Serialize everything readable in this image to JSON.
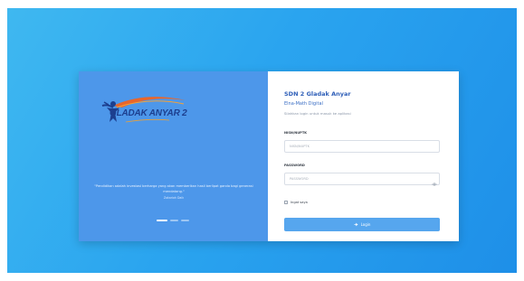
{
  "brand": {
    "logo_text": "GLADAK ANYAR 2"
  },
  "quote": {
    "text": "\"Pendidikan adalah investasi berharga yang akan memberikan hasil berlipat ganda bagi generasi mendatang.\"",
    "author": "Zakariah Daik"
  },
  "carousel": {
    "slides": 3,
    "active_index": 0
  },
  "login": {
    "school_name": "SDN 2 Gladak Anyar",
    "app_name": "Elna-Math Digital",
    "subtitle": "Silahkan login untuk masuk ke aplikasi",
    "username_label": "NISN/NUPTK",
    "username_placeholder": "NISN/NUPTK",
    "password_label": "PASSWORD",
    "password_placeholder": "PASSWORD",
    "remember_label": "Ingat saya",
    "button_label": "Login"
  },
  "colors": {
    "background_gradient_start": "#3fb8f0",
    "background_gradient_end": "#1e8fe8",
    "left_panel": "#4d97ea",
    "button": "#56a6ee",
    "heading": "#2f5fb8"
  },
  "icons": {
    "password_toggle": "eye-icon",
    "login": "login-icon"
  }
}
